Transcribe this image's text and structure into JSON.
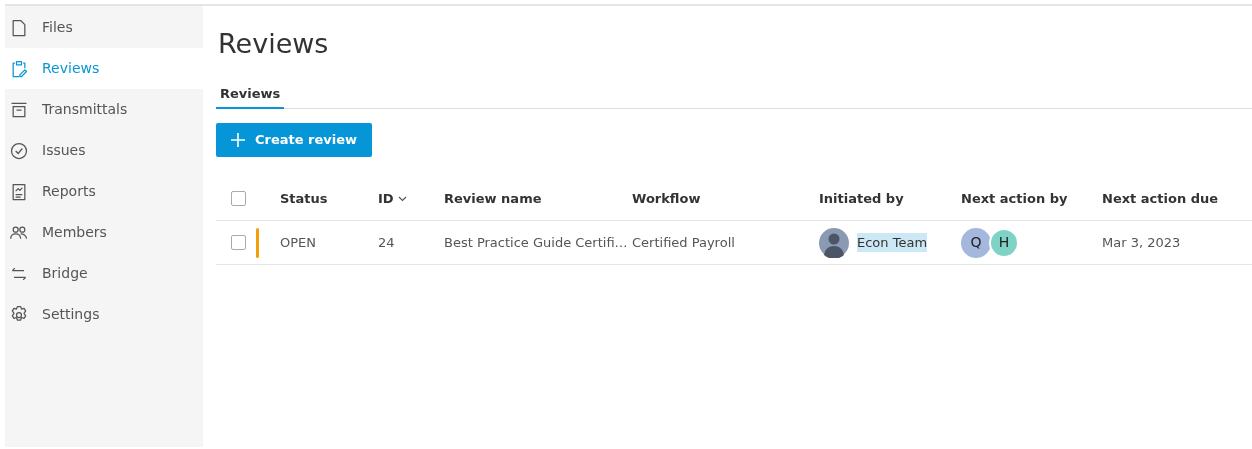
{
  "sidebar": {
    "items": [
      {
        "label": "Files",
        "selected": false
      },
      {
        "label": "Reviews",
        "selected": true
      },
      {
        "label": "Transmittals",
        "selected": false
      },
      {
        "label": "Issues",
        "selected": false
      },
      {
        "label": "Reports",
        "selected": false
      },
      {
        "label": "Members",
        "selected": false
      },
      {
        "label": "Bridge",
        "selected": false
      },
      {
        "label": "Settings",
        "selected": false
      }
    ]
  },
  "page_title": "Reviews",
  "tabs": [
    {
      "label": "Reviews",
      "selected": true
    }
  ],
  "create_button": "Create review",
  "table": {
    "columns": [
      {
        "label": "Status",
        "sorted": false
      },
      {
        "label": "ID",
        "sorted": true
      },
      {
        "label": "Review name",
        "sorted": false
      },
      {
        "label": "Workflow",
        "sorted": false
      },
      {
        "label": "Initiated by",
        "sorted": false
      },
      {
        "label": "Next action by",
        "sorted": false
      },
      {
        "label": "Next action due",
        "sorted": false
      }
    ],
    "header_checked": false,
    "rows": [
      {
        "checked": false,
        "color": "#f59e0b",
        "status": "OPEN",
        "id": "24",
        "review_name": "Best Practice Guide Certifi…",
        "workflow": "Certified Payroll",
        "initiated_by": {
          "name": "Econ Team",
          "highlighted": true
        },
        "next_action_by": [
          {
            "initial": "Q",
            "color": "#a3b8dc"
          },
          {
            "initial": "H",
            "color": "#7fd3c6"
          }
        ],
        "next_action_due": "Mar 3, 2023"
      }
    ]
  }
}
